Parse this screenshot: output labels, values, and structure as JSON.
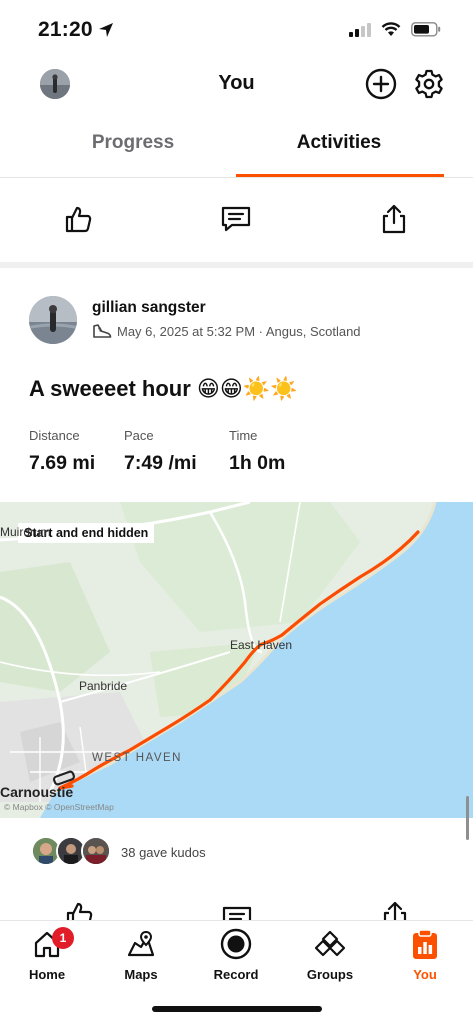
{
  "status_bar": {
    "time": "21:20"
  },
  "header": {
    "title": "You"
  },
  "tabs": [
    {
      "label": "Progress",
      "active": false
    },
    {
      "label": "Activities",
      "active": true
    }
  ],
  "top_actions": [
    "thumbs-up-icon",
    "comment-icon",
    "share-icon"
  ],
  "activity": {
    "athlete": "gillian sangster",
    "meta": "May 6, 2025 at 5:32 PM · Angus, Scotland",
    "title": "A sweeeet hour 😁😁☀️☀️",
    "stats": [
      {
        "label": "Distance",
        "value": "7.69 mi"
      },
      {
        "label": "Pace",
        "value": "7:49 /mi"
      },
      {
        "label": "Time",
        "value": "1h 0m"
      }
    ]
  },
  "map": {
    "privacy_label": "Start and end hidden",
    "places": [
      "Muirdrum",
      "East Haven",
      "Panbride",
      "WEST HAVEN",
      "Carnoustie"
    ],
    "attribution": "© Mapbox © OpenStreetMap",
    "route_color": "#fc4c02",
    "water_color": "#aadaf6"
  },
  "kudos": {
    "text": "38 gave kudos"
  },
  "tabbar": {
    "items": [
      {
        "label": "Home",
        "icon": "home-icon",
        "badge": "1",
        "active": false
      },
      {
        "label": "Maps",
        "icon": "maps-icon",
        "active": false
      },
      {
        "label": "Record",
        "icon": "record-icon",
        "active": false
      },
      {
        "label": "Groups",
        "icon": "groups-icon",
        "active": false
      },
      {
        "label": "You",
        "icon": "you-icon",
        "active": true
      }
    ]
  },
  "colors": {
    "accent": "#fc5200",
    "badge": "#e11d2a"
  }
}
